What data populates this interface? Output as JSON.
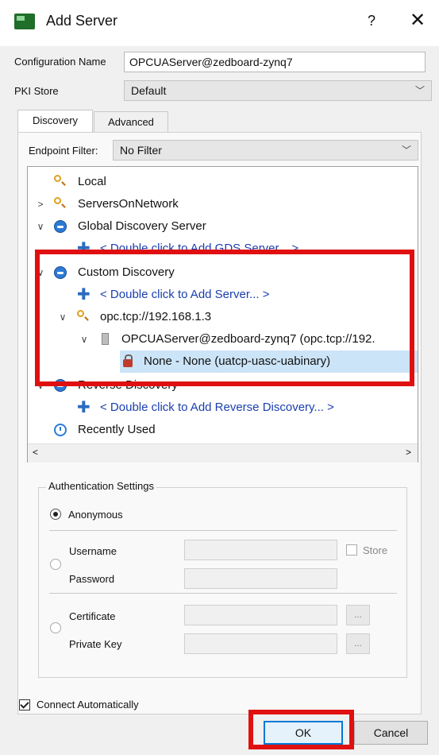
{
  "window": {
    "title": "Add Server",
    "help_label": "?",
    "close_label": "✕"
  },
  "form": {
    "config_name_label": "Configuration Name",
    "config_name_value": "OPCUAServer@zedboard-zynq7",
    "pki_label": "PKI Store",
    "pki_value": "Default"
  },
  "tabs": [
    {
      "label": "Discovery"
    },
    {
      "label": "Advanced"
    }
  ],
  "endpoint_filter": {
    "label": "Endpoint Filter:",
    "value": "No Filter"
  },
  "tree": {
    "items": [
      {
        "label": "Local",
        "icon": "magnifier-icon"
      },
      {
        "label": "ServersOnNetwork",
        "icon": "magnifier-icon"
      },
      {
        "label": "Global Discovery Server",
        "icon": "globe-icon"
      },
      {
        "label": "< Double click to Add GDS Server... >",
        "icon": "plus-icon"
      },
      {
        "label": "Custom Discovery",
        "icon": "globe-icon"
      },
      {
        "label": "< Double click to Add Server... >",
        "icon": "plus-icon"
      },
      {
        "label": "opc.tcp://192.168.1.3",
        "icon": "magnifier-icon"
      },
      {
        "label": "OPCUAServer@zedboard-zynq7 (opc.tcp://192.",
        "icon": "server-icon"
      },
      {
        "label": "None - None (uatcp-uasc-uabinary)",
        "icon": "lock-icon"
      },
      {
        "label": "Reverse Discovery",
        "icon": "globe-icon"
      },
      {
        "label": "< Double click to Add Reverse Discovery... >",
        "icon": "plus-icon"
      },
      {
        "label": "Recently Used",
        "icon": "clock-icon"
      }
    ]
  },
  "auth": {
    "title": "Authentication Settings",
    "anonymous_label": "Anonymous",
    "username_label": "Username",
    "password_label": "Password",
    "store_label": "Store",
    "certificate_label": "Certificate",
    "private_key_label": "Private Key",
    "browse_label": "..."
  },
  "connect_auto_label": "Connect Automatically",
  "buttons": {
    "ok": "OK",
    "cancel": "Cancel"
  },
  "colors": {
    "highlight_box": "#e01010",
    "link": "#1a3fb0",
    "selection": "#cce4f7"
  }
}
